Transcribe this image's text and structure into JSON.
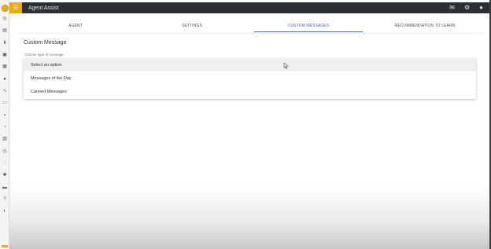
{
  "app": {
    "title": "Agent Assist"
  },
  "tabs": [
    {
      "label": "AGENT",
      "active": false
    },
    {
      "label": "SETTINGS",
      "active": false
    },
    {
      "label": "CUSTOM MESSAGES",
      "active": true
    },
    {
      "label": "RECOMMENDATION TO LEARN",
      "active": false
    }
  ],
  "content": {
    "section_title": "Custom Message",
    "field_label": "Choose type of message"
  },
  "dropdown": {
    "options": [
      {
        "label": "Select an option",
        "selected": true
      },
      {
        "label": "Messages of the Day",
        "selected": false
      },
      {
        "label": "Canned Messages",
        "selected": false
      }
    ]
  },
  "colors": {
    "accent": "#e8a92a",
    "topbar": "#2c3136",
    "active_tab": "#5063b5"
  },
  "icons": {
    "topbar": [
      "message-icon",
      "settings-icon",
      "account-icon"
    ],
    "sidebar": [
      "home-icon",
      "book-icon",
      "download-icon",
      "chat-icon",
      "calendar-icon",
      "globe-icon",
      "pulse-icon",
      "clipboard-icon",
      "grid-icon",
      "clock-icon",
      "document-icon",
      "history-icon",
      "timer-icon",
      "gear-icon",
      "toggle-icon",
      "help-icon",
      "palette-icon"
    ]
  }
}
